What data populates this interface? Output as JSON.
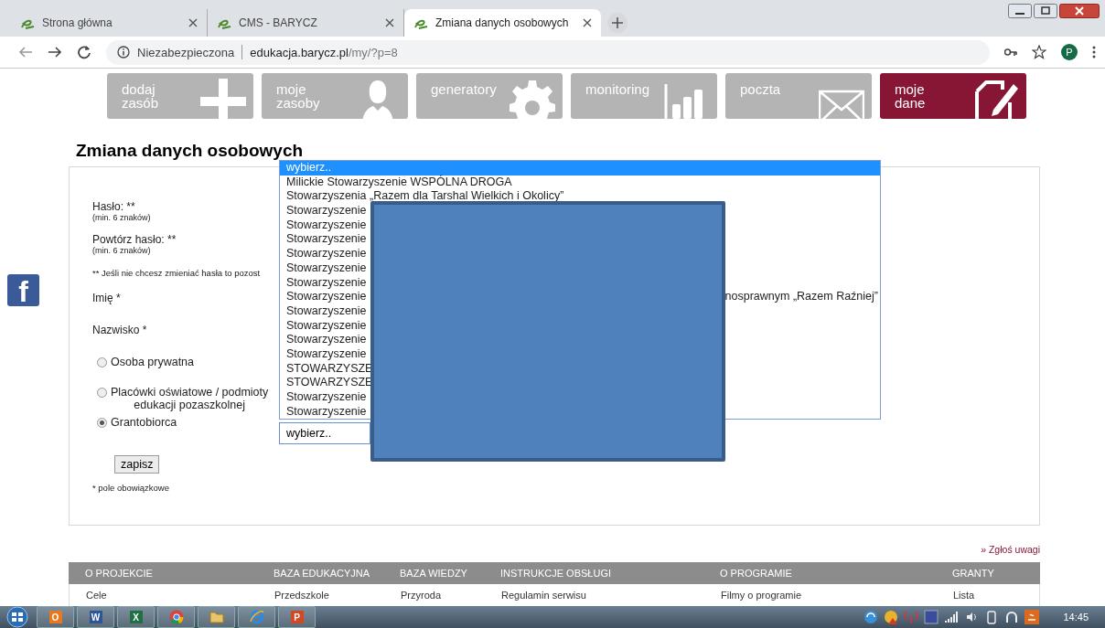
{
  "browser": {
    "tabs": [
      {
        "title": "Strona główna",
        "selected": false
      },
      {
        "title": "CMS - BARYCZ",
        "selected": false
      },
      {
        "title": "Zmiana danych osobowych",
        "selected": true
      }
    ],
    "security": "Niezabezpieczona",
    "url_host": "edukacja.barycz.pl",
    "url_path": "/my/?p=8",
    "profile": "P"
  },
  "nav": [
    {
      "label": "dodaj\nzasób",
      "selected": false
    },
    {
      "label": "moje\nzasoby",
      "selected": false
    },
    {
      "label": "generatory",
      "selected": false
    },
    {
      "label": "monitoring",
      "selected": false
    },
    {
      "label": "poczta",
      "selected": false
    },
    {
      "label": "moje\ndane",
      "selected": true
    }
  ],
  "facebook": {
    "label": "f"
  },
  "title": "Zmiana danych osobowych",
  "form": {
    "fields": [
      {
        "label": "Hasło: **",
        "hint": "(min. 6 znaków)"
      },
      {
        "label": "Powtórz hasło: **",
        "hint": "(min. 6 znaków)"
      }
    ],
    "password_note": "** Jeśli nie chcesz zmieniać hasła to pozost",
    "name_fields": [
      "Imię *",
      "Nazwisko *"
    ],
    "types": [
      {
        "label": "Osoba prywatna",
        "selected": false
      },
      {
        "label": "Placówki oświatowe / podmioty\nedukacji pozaszkolnej",
        "selected": false
      },
      {
        "label": "Grantobiorca",
        "selected": true
      }
    ],
    "select_value": "wybierz..",
    "options": [
      {
        "text": "wybierz..",
        "selected": true
      },
      {
        "text": "Milickie Stowarzyszenie WSPÓLNA DROGA",
        "selected": false
      },
      {
        "text": "Stowarzyszenia „Razem dla Tarshal Wielkich i Okolicy”",
        "selected": false
      },
      {
        "text": "Stowarzyszenie",
        "selected": false
      },
      {
        "text": "Stowarzyszenie",
        "selected": false
      },
      {
        "text": "Stowarzyszenie",
        "selected": false
      },
      {
        "text": "Stowarzyszenie",
        "selected": false
      },
      {
        "text": "Stowarzyszenie",
        "selected": false
      },
      {
        "text": "Stowarzyszenie",
        "selected": false
      },
      {
        "text": "Stowarzyszenie",
        "tail": "nosprawnym „Razem Raźniej”",
        "selected": false
      },
      {
        "text": "Stowarzyszenie",
        "selected": false
      },
      {
        "text": "Stowarzyszenie",
        "selected": false
      },
      {
        "text": "Stowarzyszenie",
        "selected": false
      },
      {
        "text": "Stowarzyszenie",
        "selected": false
      },
      {
        "text": "STOWARZYSZE",
        "selected": false
      },
      {
        "text": "STOWARZYSZE",
        "selected": false
      },
      {
        "text": "Stowarzyszenie",
        "selected": false
      },
      {
        "text": "Stowarzyszenie",
        "selected": false
      }
    ],
    "save": "zapisz",
    "required_note": "* pole obowiązkowe"
  },
  "report_link": "» Zgłoś uwagi",
  "footer": {
    "columns": [
      "O PROJEKCIE",
      "BAZA EDUKACYJNA",
      "BAZA WIEDZY",
      "INSTRUKCJE OBSŁUGI",
      "O PROGRAMIE",
      "GRANTY"
    ],
    "row": [
      "Cele",
      "Przedszkole",
      "Przyroda",
      "Regulamin serwisu",
      "Filmy o programie",
      "Lista"
    ]
  },
  "taskbar": {
    "apps": [
      {
        "kind": "letter",
        "label": "O",
        "color": "#e8781e"
      },
      {
        "kind": "letter",
        "label": "W",
        "color": "#2b5797"
      },
      {
        "kind": "letter",
        "label": "X",
        "color": "#1e7145"
      },
      {
        "kind": "chrome"
      },
      {
        "kind": "folder"
      },
      {
        "kind": "ie"
      },
      {
        "kind": "letter",
        "label": "P",
        "color": "#d24726"
      }
    ],
    "clock": "14:45"
  }
}
